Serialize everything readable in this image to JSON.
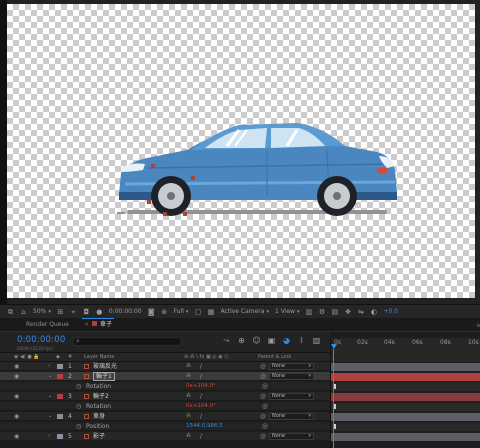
{
  "viewer": {
    "zoom": "50%",
    "timecode": "0:00:00:00",
    "resolution": "Full",
    "camera": "Active Camera",
    "views": "1 View",
    "exposure": "+0.0"
  },
  "tabs": [
    {
      "label": "Render Queue",
      "active": false
    },
    {
      "label": "車子",
      "active": true
    }
  ],
  "timeline": {
    "current_time": "0:00:00:00",
    "fps_info": "00000 (25.00 fps)",
    "search_placeholder": "",
    "columns": {
      "layer_name": "Layer Name",
      "parent": "Parent & Link"
    },
    "ruler_ticks": [
      "0s",
      "02s",
      "04s",
      "06s",
      "08s",
      "10s"
    ],
    "layers": [
      {
        "kind": "layer",
        "num": "1",
        "name": "玻璃反光",
        "parent": "None",
        "color": "#8a8f9e",
        "bar": "gray"
      },
      {
        "kind": "layer",
        "num": "2",
        "name": "輪子1",
        "parent": "None",
        "color": "#b24040",
        "bar": "red",
        "selected": true
      },
      {
        "kind": "prop",
        "name": "Rotation",
        "value": "0x+104.0°",
        "bar": "prop"
      },
      {
        "kind": "layer",
        "num": "3",
        "name": "輪子2",
        "parent": "None",
        "color": "#b24040",
        "bar": "red"
      },
      {
        "kind": "prop",
        "name": "Rotation",
        "value": "0x+104.0°",
        "bar": "prop"
      },
      {
        "kind": "layer",
        "num": "4",
        "name": "車身",
        "parent": "None",
        "color": "#8a8f9e",
        "bar": "gray"
      },
      {
        "kind": "prop",
        "name": "Position",
        "value": "1544.0,986.5",
        "bar": "prop",
        "blue": true
      },
      {
        "kind": "layer",
        "num": "5",
        "name": "影子",
        "parent": "None",
        "color": "#8a8f9e",
        "bar": "gray"
      }
    ]
  },
  "colors": {
    "accent": "#2d8ceb",
    "car_body": "#4a86c0",
    "layer_red": "#b24040"
  }
}
